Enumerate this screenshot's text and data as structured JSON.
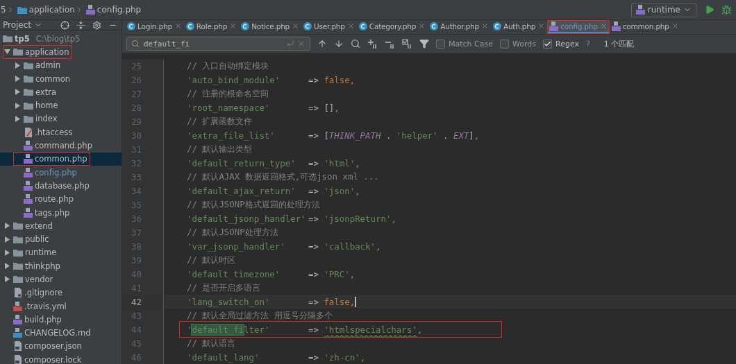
{
  "breadcrumb": [
    {
      "label": "5"
    },
    {
      "label": "application",
      "kind": "folder"
    },
    {
      "label": "config.php",
      "kind": "php"
    }
  ],
  "run_config": {
    "label": "runtime"
  },
  "project": {
    "label": "Project",
    "root": {
      "name": "tp5",
      "path": "C:\\blog\\tp5",
      "children": [
        {
          "name": "application",
          "kind": "folder",
          "expanded": true,
          "selected": false,
          "marked": true,
          "modified": false,
          "children": [
            {
              "name": "admin",
              "kind": "folder",
              "expanded": false,
              "selected": false,
              "marked": false,
              "modified": false
            },
            {
              "name": "common",
              "kind": "folder",
              "expanded": false,
              "selected": false,
              "marked": false,
              "modified": false
            },
            {
              "name": "extra",
              "kind": "folder",
              "expanded": false,
              "selected": false,
              "marked": false,
              "modified": false
            },
            {
              "name": "home",
              "kind": "folder",
              "expanded": false,
              "selected": false,
              "marked": false,
              "modified": false
            },
            {
              "name": "index",
              "kind": "folder",
              "expanded": false,
              "selected": false,
              "marked": false,
              "modified": false
            },
            {
              "name": ".htaccess",
              "kind": "htaccess",
              "selected": false,
              "marked": false,
              "modified": false
            },
            {
              "name": "command.php",
              "kind": "php",
              "selected": false,
              "marked": false,
              "modified": false
            },
            {
              "name": "common.php",
              "kind": "php",
              "selected": true,
              "marked": true,
              "modified": false
            },
            {
              "name": "config.php",
              "kind": "php",
              "selected": false,
              "marked": false,
              "modified": true
            },
            {
              "name": "database.php",
              "kind": "php",
              "selected": false,
              "marked": false,
              "modified": false
            },
            {
              "name": "route.php",
              "kind": "php",
              "selected": false,
              "marked": false,
              "modified": false
            },
            {
              "name": "tags.php",
              "kind": "php",
              "selected": false,
              "marked": false,
              "modified": false
            }
          ]
        },
        {
          "name": "extend",
          "kind": "folder",
          "expanded": false,
          "selected": false,
          "marked": false,
          "modified": false
        },
        {
          "name": "public",
          "kind": "folder",
          "expanded": false,
          "selected": false,
          "marked": false,
          "modified": false
        },
        {
          "name": "runtime",
          "kind": "folder",
          "expanded": false,
          "selected": false,
          "marked": false,
          "modified": false
        },
        {
          "name": "thinkphp",
          "kind": "folder",
          "expanded": false,
          "selected": false,
          "marked": false,
          "modified": false
        },
        {
          "name": "vendor",
          "kind": "folder",
          "expanded": false,
          "selected": false,
          "marked": false,
          "modified": false
        },
        {
          "name": ".gitignore",
          "kind": "ignore",
          "selected": false,
          "marked": false,
          "modified": false
        },
        {
          "name": ".travis.yml",
          "kind": "yml",
          "selected": false,
          "marked": false,
          "modified": false
        },
        {
          "name": "build.php",
          "kind": "php",
          "selected": false,
          "marked": false,
          "modified": false
        },
        {
          "name": "CHANGELOG.md",
          "kind": "md",
          "selected": false,
          "marked": false,
          "modified": false
        },
        {
          "name": "composer.json",
          "kind": "json",
          "selected": false,
          "marked": false,
          "modified": false
        },
        {
          "name": "composer.lock",
          "kind": "json",
          "selected": false,
          "marked": false,
          "modified": false
        }
      ]
    }
  },
  "tabs": [
    {
      "label": "Login.php",
      "kind": "class",
      "selected": false,
      "marked": false
    },
    {
      "label": "Role.php",
      "kind": "class",
      "selected": false,
      "marked": false
    },
    {
      "label": "Notice.php",
      "kind": "class",
      "selected": false,
      "marked": false
    },
    {
      "label": "User.php",
      "kind": "class",
      "selected": false,
      "marked": false
    },
    {
      "label": "Category.php",
      "kind": "class",
      "selected": false,
      "marked": false
    },
    {
      "label": "Author.php",
      "kind": "class",
      "selected": false,
      "marked": false
    },
    {
      "label": "Auth.php",
      "kind": "class",
      "selected": false,
      "marked": false
    },
    {
      "label": "config.php",
      "kind": "php",
      "selected": true,
      "marked": true
    },
    {
      "label": "common.php",
      "kind": "php",
      "selected": false,
      "marked": false
    }
  ],
  "find_bar": {
    "value": "default_fi",
    "options": [
      {
        "label": "Match Case",
        "checked": false
      },
      {
        "label": "Words",
        "checked": false
      },
      {
        "label": "Regex",
        "checked": true
      }
    ],
    "help": "?",
    "result": "1 个匹配"
  },
  "code": [
    {
      "number": "25",
      "current": false,
      "marked": false,
      "comment": "// 入口自动绑定模块"
    },
    {
      "number": "26",
      "current": false,
      "marked": false,
      "key": [
        {
          "kind": "string",
          "text": "'auto_bind_module'"
        }
      ],
      "arrow": "=>",
      "value": [
        {
          "kind": "keyword",
          "text": "false"
        },
        {
          "kind": "punct",
          "text": ","
        }
      ]
    },
    {
      "number": "27",
      "current": false,
      "marked": false,
      "comment": "// 注册的根命名空间"
    },
    {
      "number": "28",
      "current": false,
      "marked": false,
      "key": [
        {
          "kind": "string",
          "text": "'root_namespace'"
        }
      ],
      "arrow": "=>",
      "value": [
        {
          "kind": "plain",
          "text": "[]"
        },
        {
          "kind": "punct",
          "text": ","
        }
      ]
    },
    {
      "number": "29",
      "current": false,
      "marked": false,
      "comment": "// 扩展函数文件"
    },
    {
      "number": "30",
      "current": false,
      "marked": false,
      "key": [
        {
          "kind": "string",
          "text": "'extra_file_list'"
        }
      ],
      "arrow": "=>",
      "value": [
        {
          "kind": "plain",
          "text": "["
        },
        {
          "kind": "const",
          "text": "THINK_PATH"
        },
        {
          "kind": "plain",
          "text": " . "
        },
        {
          "kind": "string",
          "text": "'helper'"
        },
        {
          "kind": "plain",
          "text": " . "
        },
        {
          "kind": "const",
          "text": "EXT"
        },
        {
          "kind": "plain",
          "text": "]"
        },
        {
          "kind": "punct",
          "text": ","
        }
      ]
    },
    {
      "number": "31",
      "current": false,
      "marked": false,
      "comment": "// 默认输出类型"
    },
    {
      "number": "32",
      "current": false,
      "marked": false,
      "key": [
        {
          "kind": "string",
          "text": "'default_return_type'"
        }
      ],
      "arrow": "=>",
      "value": [
        {
          "kind": "string",
          "text": "'html'"
        },
        {
          "kind": "punct",
          "text": ","
        }
      ]
    },
    {
      "number": "33",
      "current": false,
      "marked": false,
      "comment": "// 默认AJAX 数据返回格式,可选json xml ..."
    },
    {
      "number": "34",
      "current": false,
      "marked": false,
      "key": [
        {
          "kind": "string",
          "text": "'default_ajax_return'"
        }
      ],
      "arrow": "=>",
      "value": [
        {
          "kind": "string",
          "text": "'json'"
        },
        {
          "kind": "punct",
          "text": ","
        }
      ]
    },
    {
      "number": "35",
      "current": false,
      "marked": false,
      "comment": "// 默认JSONP格式返回的处理方法"
    },
    {
      "number": "36",
      "current": false,
      "marked": false,
      "key": [
        {
          "kind": "string",
          "text": "'default_jsonp_handler'"
        }
      ],
      "arrow": "=>",
      "value": [
        {
          "kind": "string",
          "text": "'jsonpReturn'"
        },
        {
          "kind": "punct",
          "text": ","
        }
      ]
    },
    {
      "number": "37",
      "current": false,
      "marked": false,
      "comment": "// 默认JSONP处理方法"
    },
    {
      "number": "38",
      "current": false,
      "marked": false,
      "key": [
        {
          "kind": "string",
          "text": "'var_jsonp_handler'"
        }
      ],
      "arrow": "=>",
      "value": [
        {
          "kind": "string",
          "text": "'callback'"
        },
        {
          "kind": "punct",
          "text": ","
        }
      ]
    },
    {
      "number": "39",
      "current": false,
      "marked": false,
      "comment": "// 默认时区"
    },
    {
      "number": "40",
      "current": false,
      "marked": false,
      "key": [
        {
          "kind": "string",
          "text": "'default_timezone'"
        }
      ],
      "arrow": "=>",
      "value": [
        {
          "kind": "string",
          "text": "'PRC'"
        },
        {
          "kind": "punct",
          "text": ","
        }
      ]
    },
    {
      "number": "41",
      "current": false,
      "marked": false,
      "comment": "// 是否开启多语言"
    },
    {
      "number": "42",
      "current": true,
      "marked": false,
      "key": [
        {
          "kind": "string",
          "text": "'lang_switch_on'"
        }
      ],
      "arrow": "=>",
      "value": [
        {
          "kind": "keyword",
          "text": "false"
        },
        {
          "kind": "punct",
          "text": ","
        }
      ]
    },
    {
      "number": "43",
      "current": false,
      "marked": false,
      "comment": "// 默认全局过滤方法 用逗号分隔多个"
    },
    {
      "number": "44",
      "current": false,
      "marked": true,
      "key": [
        {
          "kind": "string",
          "text": "'"
        },
        {
          "kind": "match",
          "text": "default_fi"
        },
        {
          "kind": "string",
          "text": "lter'"
        }
      ],
      "arrow": "=>",
      "value": [
        {
          "kind": "spelling",
          "text": "'htmlspecialchars'"
        },
        {
          "kind": "punct",
          "text": ","
        }
      ]
    },
    {
      "number": "45",
      "current": false,
      "marked": false,
      "comment": "// 默认语言"
    },
    {
      "number": "46",
      "current": false,
      "marked": false,
      "key": [
        {
          "kind": "string",
          "text": "'default_lang'"
        }
      ],
      "arrow": "=>",
      "value": [
        {
          "kind": "string",
          "text": "'zh-cn'"
        },
        {
          "kind": "punct",
          "text": ","
        }
      ]
    }
  ]
}
